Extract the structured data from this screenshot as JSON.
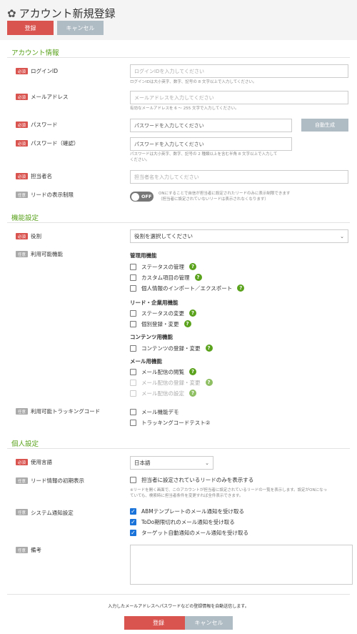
{
  "header": {
    "title": "アカウント新規登録",
    "register_label": "登録",
    "cancel_label": "キャンセル"
  },
  "badges": {
    "required": "必須",
    "optional": "任意"
  },
  "account_section": {
    "title": "アカウント情報",
    "login_id": {
      "label": "ログインID",
      "placeholder": "ログインIDを入力してください",
      "help": "ログインIDは大小英字、数字、記号の 8 文字以上で入力してください。"
    },
    "email": {
      "label": "メールアドレス",
      "placeholder": "メールアドレスを入力してください",
      "help": "有効なメールアドレスを 6 〜 255 文字で入力してください。"
    },
    "password": {
      "label": "パスワード",
      "placeholder": "パスワードを入力してください",
      "generate_label": "自動生成"
    },
    "password_confirm": {
      "label": "パスワード（確認）",
      "placeholder": "パスワードを入力してください",
      "help_line1": "パスワードは大小英字、数字、記号の 2 種類以上を含む半角 8 文字以上で入力して",
      "help_line2": "ください。"
    },
    "person": {
      "label": "担当者名",
      "placeholder": "担当者名を入力してください"
    },
    "lead_restrict": {
      "label": "リードの表示制限",
      "toggle_text": "OFF",
      "help_line1": "ONにすることで自信が担当者に設定されたリードのみに表示制限できます",
      "help_line2": "（担当者に設定されていないリードは表示されなくなります）"
    }
  },
  "feature_section": {
    "title": "機能設定",
    "role": {
      "label": "役割",
      "selected": "役割を選択してください"
    },
    "features": {
      "label": "利用可能機能",
      "admin_title": "管理用機能",
      "status_manage": "ステータスの管理",
      "custom_items": "カスタム項目の管理",
      "import_export": "個人情報のインポート／エクスポート",
      "lead_title": "リード・企業用機能",
      "status_change": "ステータスの変更",
      "individual_edit": "個別登録・変更",
      "contents_title": "コンテンツ用機能",
      "contents_edit": "コンテンツの登録・変更",
      "mail_title": "メール用機能",
      "mail_view": "メール配信の閲覧",
      "mail_edit": "メール配信の登録・変更",
      "mail_settings": "メール配信の設定"
    },
    "tracking": {
      "label": "利用可能トラッキングコード",
      "code1": "メール機能デモ",
      "code2": "トラッキングコードテスト②"
    }
  },
  "personal_section": {
    "title": "個人設定",
    "language": {
      "label": "使用言語",
      "selected": "日本語"
    },
    "lead_default": {
      "label": "リード情報の初期表示",
      "option": "担当者に設定されているリードのみを表示する",
      "note_line1": "※リードを開く画面で、このアカウントが担当者に設定されているリードの一覧を表示します。設定がONになっ",
      "note_line2": "ていても、検索時に担当者条件を変更すれば全件表示できます。"
    },
    "notification": {
      "label": "システム通知設定",
      "opt1": "ABMテンプレートのメール通知を受け取る",
      "opt2": "ToDo期限切れのメール通知を受け取る",
      "opt3": "ターゲット自動通知のメール通知を受け取る"
    },
    "memo": {
      "label": "備考"
    }
  },
  "footer": {
    "notice": "入力したメールアドレスへパスワードなどの登録情報を自動送信します。",
    "register_label": "登録",
    "cancel_label": "キャンセル"
  }
}
